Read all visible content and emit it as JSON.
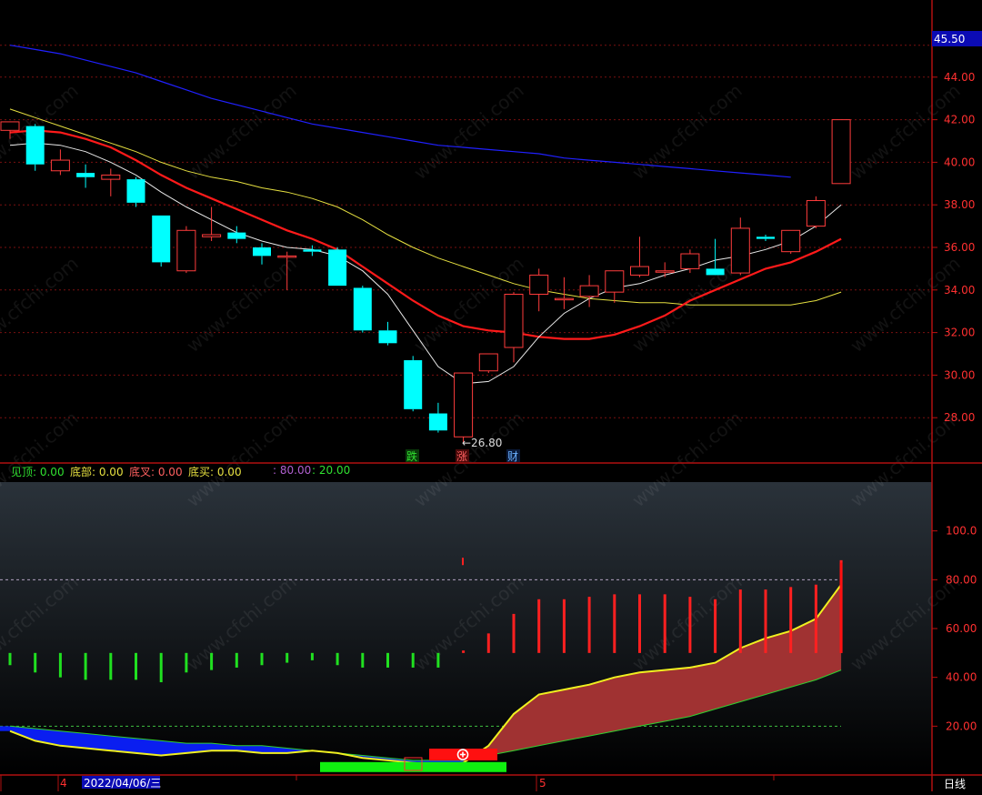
{
  "colors": {
    "up": "#ff3c3c",
    "down": "#00ffff",
    "grid": "#7a1010",
    "axis_text": "#ff3030",
    "ma_white": "#e8e8e8",
    "ma_red": "#ff1a1a",
    "ma_yellow": "#e6e040",
    "ma_blue": "#2020ff",
    "blue_fill": "#0a1ef0",
    "red_fill": "#a03232",
    "osc_up": "#ff2020",
    "osc_down": "#20e020"
  },
  "watermark": "www.cfchi.com",
  "price_axis": {
    "current_price": "45.50",
    "tick_labels": [
      "44.00",
      "42.00",
      "40.00",
      "38.00",
      "36.00",
      "34.00",
      "32.00",
      "30.00",
      "28.00"
    ]
  },
  "annotations": {
    "low_marker": "←26.80",
    "event_labels": [
      "跌",
      "涨",
      "财"
    ]
  },
  "indicator": {
    "labels": [
      {
        "text": "见顶: 0.00",
        "color": "#30e030"
      },
      {
        "text": "底部: 0.00",
        "color": "#e6e040"
      },
      {
        "text": "底叉: 0.00",
        "color": "#ff6060"
      },
      {
        "text": "底买: 0.00",
        "color": "#e6e040"
      },
      {
        "text": ": 80.00",
        "color": "#b060d0"
      },
      {
        "text": ": 20.00",
        "color": "#30e030"
      }
    ],
    "axis_labels": [
      "100.0",
      "80.00",
      "60.00",
      "40.00",
      "20.00"
    ]
  },
  "bottom_bar": {
    "month_marker_1": "4",
    "date_label": "2022/04/06/三",
    "month_marker_2": "5",
    "period_label": "日线"
  },
  "chart_data": {
    "type": "candlestick",
    "price_ylim": [
      26,
      46
    ],
    "candles": [
      {
        "o": 41.5,
        "h": 41.9,
        "l": 41.1,
        "c": 41.9
      },
      {
        "o": 41.7,
        "h": 41.8,
        "l": 39.6,
        "c": 39.9
      },
      {
        "o": 39.6,
        "h": 40.6,
        "l": 39.4,
        "c": 40.1
      },
      {
        "o": 39.5,
        "h": 39.9,
        "l": 38.8,
        "c": 39.3
      },
      {
        "o": 39.2,
        "h": 39.7,
        "l": 38.4,
        "c": 39.4
      },
      {
        "o": 39.2,
        "h": 39.3,
        "l": 37.9,
        "c": 38.1
      },
      {
        "o": 37.5,
        "h": 37.5,
        "l": 35.1,
        "c": 35.3
      },
      {
        "o": 34.9,
        "h": 37.0,
        "l": 34.8,
        "c": 36.8
      },
      {
        "o": 36.5,
        "h": 37.9,
        "l": 36.3,
        "c": 36.6
      },
      {
        "o": 36.7,
        "h": 37.0,
        "l": 36.2,
        "c": 36.4
      },
      {
        "o": 36.0,
        "h": 36.2,
        "l": 35.2,
        "c": 35.6
      },
      {
        "o": 35.6,
        "h": 35.8,
        "l": 34.0,
        "c": 35.6
      },
      {
        "o": 35.9,
        "h": 36.1,
        "l": 35.6,
        "c": 35.8
      },
      {
        "o": 35.9,
        "h": 36.0,
        "l": 34.2,
        "c": 34.2
      },
      {
        "o": 34.1,
        "h": 34.2,
        "l": 32.0,
        "c": 32.1
      },
      {
        "o": 32.1,
        "h": 32.5,
        "l": 31.4,
        "c": 31.5
      },
      {
        "o": 30.7,
        "h": 30.9,
        "l": 28.3,
        "c": 28.4
      },
      {
        "o": 28.2,
        "h": 28.7,
        "l": 27.3,
        "c": 27.4
      },
      {
        "o": 27.1,
        "h": 30.1,
        "l": 26.8,
        "c": 30.1
      },
      {
        "o": 30.2,
        "h": 31.0,
        "l": 30.1,
        "c": 31.0
      },
      {
        "o": 31.3,
        "h": 33.9,
        "l": 30.6,
        "c": 33.8
      },
      {
        "o": 33.8,
        "h": 35.0,
        "l": 33.0,
        "c": 34.7
      },
      {
        "o": 33.6,
        "h": 34.6,
        "l": 33.1,
        "c": 33.6
      },
      {
        "o": 33.7,
        "h": 34.7,
        "l": 33.2,
        "c": 34.2
      },
      {
        "o": 33.9,
        "h": 34.9,
        "l": 33.4,
        "c": 34.9
      },
      {
        "o": 34.7,
        "h": 36.5,
        "l": 34.6,
        "c": 35.1
      },
      {
        "o": 34.9,
        "h": 35.3,
        "l": 34.6,
        "c": 34.9
      },
      {
        "o": 35.0,
        "h": 35.9,
        "l": 34.8,
        "c": 35.7
      },
      {
        "o": 35.0,
        "h": 36.4,
        "l": 34.8,
        "c": 34.7
      },
      {
        "o": 34.8,
        "h": 37.4,
        "l": 34.7,
        "c": 36.9
      },
      {
        "o": 36.5,
        "h": 36.6,
        "l": 36.3,
        "c": 36.4
      },
      {
        "o": 35.8,
        "h": 36.8,
        "l": 35.7,
        "c": 36.8
      },
      {
        "o": 37.0,
        "h": 38.4,
        "l": 36.9,
        "c": 38.2
      },
      {
        "o": 39.0,
        "h": 42.0,
        "l": 39.0,
        "c": 42.0
      }
    ],
    "ma_white": [
      40.8,
      40.9,
      40.8,
      40.5,
      40.0,
      39.4,
      38.6,
      37.9,
      37.3,
      36.7,
      36.3,
      36.0,
      35.9,
      35.6,
      34.9,
      33.8,
      32.1,
      30.4,
      29.6,
      29.7,
      30.4,
      31.8,
      32.9,
      33.6,
      34.1,
      34.3,
      34.7,
      35.0,
      35.4,
      35.6,
      35.9,
      36.3,
      37.0,
      38.0
    ],
    "ma_red": [
      41.4,
      41.5,
      41.4,
      41.1,
      40.7,
      40.1,
      39.4,
      38.8,
      38.3,
      37.8,
      37.3,
      36.8,
      36.4,
      35.9,
      35.1,
      34.3,
      33.5,
      32.8,
      32.3,
      32.1,
      32.0,
      31.8,
      31.7,
      31.7,
      31.9,
      32.3,
      32.8,
      33.5,
      34.0,
      34.5,
      35.0,
      35.3,
      35.8,
      36.4
    ],
    "ma_yellow": [
      42.5,
      42.1,
      41.7,
      41.3,
      40.9,
      40.5,
      40.0,
      39.6,
      39.3,
      39.1,
      38.8,
      38.6,
      38.3,
      37.9,
      37.3,
      36.6,
      36.0,
      35.5,
      35.1,
      34.7,
      34.3,
      34.0,
      33.8,
      33.6,
      33.5,
      33.4,
      33.4,
      33.3,
      33.3,
      33.3,
      33.3,
      33.3,
      33.5,
      33.9
    ],
    "ma_blue": [
      45.5,
      45.3,
      45.1,
      44.8,
      44.5,
      44.2,
      43.8,
      43.4,
      43.0,
      42.7,
      42.4,
      42.1,
      41.8,
      41.6,
      41.4,
      41.2,
      41.0,
      40.8,
      40.7,
      40.6,
      40.5,
      40.4,
      40.2,
      40.1,
      40.0,
      39.9,
      39.8,
      39.7,
      39.6,
      39.5,
      39.4,
      39.3
    ],
    "osc_ylim": [
      0,
      120
    ],
    "osc_thresholds": [
      80,
      20
    ],
    "osc_bars": [
      -5,
      -8,
      -10,
      -11,
      -11,
      -11,
      -12,
      -8,
      -7,
      -6,
      -5,
      -4,
      -3,
      -5,
      -6,
      -6,
      -6,
      -6,
      1,
      8,
      16,
      22,
      22,
      23,
      24,
      24,
      24,
      23,
      22,
      26,
      26,
      27,
      28,
      38
    ],
    "osc_line_yellow": [
      18,
      14,
      12,
      11,
      10,
      9,
      8,
      9,
      10,
      10,
      9,
      9,
      10,
      9,
      7,
      6,
      5,
      4,
      5,
      12,
      25,
      33,
      35,
      37,
      40,
      42,
      43,
      44,
      46,
      52,
      56,
      59,
      64,
      78
    ],
    "osc_line_green": [
      20,
      19,
      18,
      17,
      16,
      15,
      14,
      13,
      13,
      12,
      12,
      11,
      10,
      9,
      8,
      7,
      6,
      6,
      6,
      8,
      10,
      12,
      14,
      16,
      18,
      20,
      22,
      24,
      27,
      30,
      33,
      36,
      39,
      43
    ]
  }
}
